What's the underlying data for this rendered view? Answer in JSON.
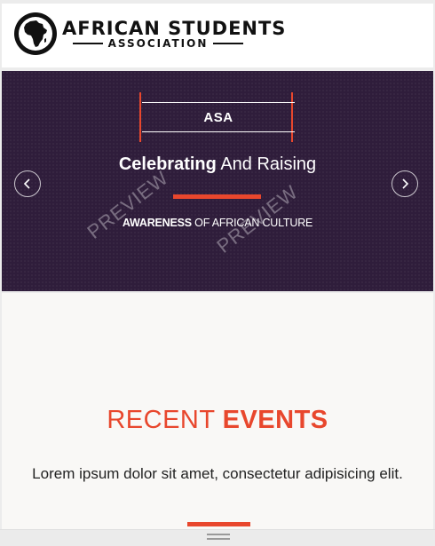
{
  "header": {
    "logo_title": "AFRICAN STUDENTS",
    "logo_subtitle": "ASSOCIATION",
    "logo_icon": "africa-map-icon"
  },
  "hero": {
    "badge": "ASA",
    "headline_bold": "Celebrating",
    "headline_rest": " And Raising",
    "subline_bold": "AWARENESS",
    "subline_rest": " OF AFRICAN CULTURE",
    "prev_icon": "chevron-left-icon",
    "next_icon": "chevron-right-icon",
    "watermarks": [
      "PREVIEW",
      "PREVIEW"
    ]
  },
  "events": {
    "title_light": "RECENT ",
    "title_bold": "EVENTS",
    "description": "Lorem ipsum dolor sit amet, consectetur adipisicing elit."
  },
  "colors": {
    "accent": "#e8472d",
    "hero_bg": "#2f1d3b",
    "section_bg": "#f9f8f6"
  }
}
